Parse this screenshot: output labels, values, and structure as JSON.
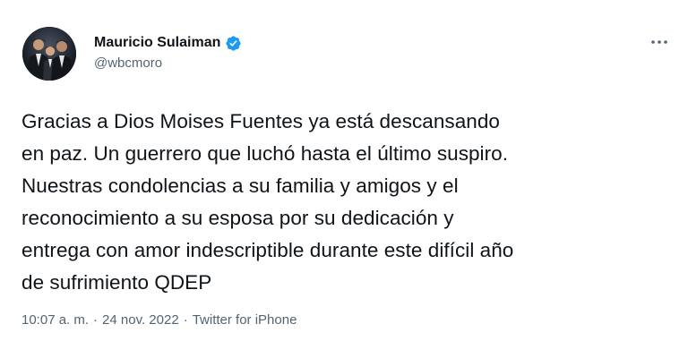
{
  "author": {
    "display_name": "Mauricio Sulaiman",
    "handle": "@wbcmoro",
    "verified": true,
    "avatar_icon": "profile-photo-icon"
  },
  "tweet": {
    "text": "Gracias a Dios Moises Fuentes ya está descansando\nen paz. Un guerrero que luchó hasta el último suspiro.\nNuestras condolencias a su familia y amigos y el\nreconocimiento a su esposa por su dedicación y\nentrega con amor indescriptible durante este difícil año\nde sufrimiento QDEP"
  },
  "meta": {
    "time": "10:07 a. m.",
    "separator": "·",
    "date": "24 nov. 2022",
    "source": "Twitter for iPhone"
  },
  "icons": {
    "more": "more-options-icon",
    "verified": "verified-badge-icon"
  },
  "colors": {
    "text_primary": "#0f1419",
    "text_secondary": "#536471",
    "verified_blue": "#1d9bf0",
    "background": "#ffffff"
  }
}
